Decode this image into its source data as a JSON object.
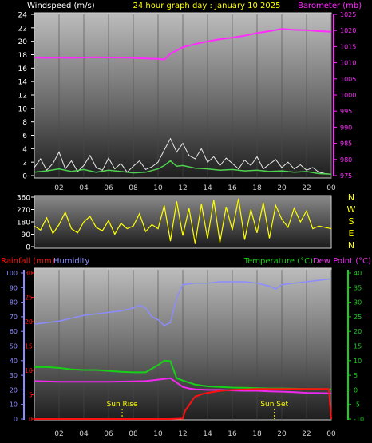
{
  "title": "24 hour graph day : January 10 2025",
  "wind_axis_label": "Windspeed (m/s)",
  "baro_axis_label": "Barometer (mb)",
  "rain_axis_label": "Rainfall (mm)",
  "hum_axis_label": "Humidity",
  "temp_axis_label": "Temperature (°C)",
  "dew_axis_label": "Dew Point (°C)",
  "sunrise_label": "Sun Rise",
  "sunset_label": "Sun Set",
  "colors": {
    "wind": "#e8e8e8",
    "gust": "#4fd14f",
    "baro": "#ff2bff",
    "dir": "#ffff00",
    "humidity": "#8c8cff",
    "temperature": "#18d018",
    "dewpoint": "#ee2aee",
    "rain": "#ff1010",
    "title": "#ffff00"
  },
  "chart_data": [
    {
      "type": "line",
      "panel": "wind_baro",
      "x_ticks": [
        "02",
        "04",
        "06",
        "08",
        "10",
        "12",
        "14",
        "16",
        "18",
        "20",
        "22",
        "00"
      ],
      "xlim": [
        0,
        24
      ],
      "y_left_ticks": [
        "0",
        "2",
        "4",
        "6",
        "8",
        "10",
        "12",
        "14",
        "16",
        "18",
        "20",
        "22",
        "24"
      ],
      "ylim_left": [
        0,
        24
      ],
      "y_right_ticks": [
        "975",
        "980",
        "985",
        "990",
        "995",
        "1000",
        "1005",
        "1010",
        "1015",
        "1020",
        "1025"
      ],
      "ylim_right": [
        975,
        1025
      ],
      "series": [
        {
          "name": "Windspeed (m/s)",
          "axis": "left",
          "x": [
            0,
            0.5,
            1,
            1.5,
            2,
            2.5,
            3,
            3.5,
            4,
            4.5,
            5,
            5.5,
            6,
            6.5,
            7,
            7.5,
            8,
            8.5,
            9,
            9.5,
            10,
            10.5,
            11,
            11.5,
            12,
            12.5,
            13,
            13.5,
            14,
            14.5,
            15,
            15.5,
            16,
            16.5,
            17,
            17.5,
            18,
            18.5,
            19,
            19.5,
            20,
            20.5,
            21,
            21.5,
            22,
            22.5,
            23,
            23.5,
            24
          ],
          "y": [
            1.2,
            2.5,
            0.8,
            1.8,
            3.5,
            1.0,
            2.2,
            0.6,
            1.5,
            3.0,
            1.2,
            0.8,
            2.6,
            1.0,
            1.8,
            0.5,
            1.4,
            2.2,
            0.9,
            1.3,
            2.0,
            3.8,
            5.5,
            3.5,
            4.8,
            3.0,
            2.5,
            4.0,
            2.0,
            2.8,
            1.5,
            2.6,
            1.8,
            1.0,
            2.3,
            1.5,
            2.8,
            1.0,
            1.7,
            2.4,
            1.2,
            2.0,
            1.0,
            1.6,
            0.8,
            1.2,
            0.5,
            0.3,
            0.2
          ]
        },
        {
          "name": "Gust",
          "axis": "left",
          "x": [
            0,
            1,
            2,
            3,
            4,
            5,
            6,
            7,
            8,
            9,
            10,
            10.5,
            11,
            11.5,
            12,
            13,
            14,
            15,
            16,
            17,
            18,
            19,
            20,
            21,
            22,
            23,
            24
          ],
          "y": [
            0.5,
            0.7,
            1.0,
            0.6,
            0.9,
            0.5,
            0.8,
            0.6,
            0.4,
            0.5,
            1.0,
            1.5,
            2.2,
            1.4,
            1.5,
            1.1,
            1.0,
            0.8,
            0.9,
            0.7,
            0.8,
            0.6,
            0.7,
            0.5,
            0.6,
            0.3,
            0.2
          ]
        },
        {
          "name": "Barometer (mb)",
          "axis": "right",
          "x": [
            0,
            1,
            2,
            3,
            4,
            5,
            6,
            7,
            8,
            9,
            10,
            10.5,
            11,
            11.5,
            12,
            13,
            14,
            15,
            16,
            17,
            18,
            19,
            20,
            21,
            22,
            23,
            24
          ],
          "y": [
            1011.6,
            1011.5,
            1011.6,
            1011.5,
            1011.6,
            1011.7,
            1011.6,
            1011.6,
            1011.5,
            1011.3,
            1011.2,
            1011.0,
            1012.8,
            1013.8,
            1014.8,
            1015.8,
            1016.6,
            1017.3,
            1017.8,
            1018.4,
            1019.2,
            1019.8,
            1020.5,
            1020.2,
            1020.1,
            1019.8,
            1019.6
          ]
        }
      ]
    },
    {
      "type": "line",
      "panel": "wind_direction",
      "ylim": [
        0,
        360
      ],
      "y_ticks": [
        "0",
        "90",
        "180",
        "270",
        "360"
      ],
      "compass_labels": [
        "N",
        "W",
        "S",
        "E",
        "N"
      ],
      "series": [
        {
          "name": "Wind Direction",
          "x": [
            0,
            0.5,
            1,
            1.5,
            2,
            2.5,
            3,
            3.5,
            4,
            4.5,
            5,
            5.5,
            6,
            6.5,
            7,
            7.5,
            8,
            8.5,
            9,
            9.5,
            10,
            10.5,
            11,
            11.5,
            12,
            12.5,
            13,
            13.5,
            14,
            14.5,
            15,
            15.5,
            16,
            16.5,
            17,
            17.5,
            18,
            18.5,
            19,
            19.5,
            20,
            20.5,
            21,
            21.5,
            22,
            22.5,
            23,
            23.5,
            24
          ],
          "y": [
            150,
            120,
            210,
            95,
            160,
            250,
            130,
            100,
            180,
            220,
            140,
            115,
            190,
            90,
            170,
            130,
            150,
            240,
            110,
            160,
            130,
            300,
            40,
            330,
            80,
            280,
            20,
            310,
            60,
            340,
            30,
            290,
            120,
            350,
            50,
            270,
            100,
            320,
            60,
            300,
            200,
            140,
            280,
            180,
            260,
            130,
            150,
            140,
            130
          ]
        }
      ]
    },
    {
      "type": "line",
      "panel": "temp_hum_rain",
      "ylim_rain": [
        0,
        30
      ],
      "y_rain_ticks": [
        "0",
        "5",
        "10",
        "15",
        "20",
        "25",
        "30"
      ],
      "ylim_humidity": [
        0,
        100
      ],
      "y_humidity_ticks": [
        "0",
        "10",
        "20",
        "30",
        "40",
        "50",
        "60",
        "70",
        "80",
        "90",
        "100"
      ],
      "ylim_temp": [
        -10,
        40
      ],
      "y_temp_ticks": [
        "-10",
        "-5",
        "0",
        "5",
        "10",
        "15",
        "20",
        "25",
        "30",
        "35",
        "40"
      ],
      "sunrise_hour": 7.1,
      "sunset_hour": 19.4,
      "series": [
        {
          "name": "Humidity",
          "x": [
            0,
            1,
            2,
            3,
            4,
            5,
            6,
            7,
            8,
            8.5,
            9,
            9.5,
            10,
            10.5,
            11,
            11.5,
            12,
            13,
            14,
            15,
            16,
            17,
            18,
            19,
            19.5,
            20,
            21,
            22,
            23,
            24
          ],
          "y": [
            65,
            66,
            67,
            69,
            71,
            72,
            73,
            74,
            76,
            78,
            76,
            70,
            68,
            64,
            66,
            83,
            92,
            93,
            93,
            94,
            94,
            94,
            93,
            91,
            89,
            92,
            93,
            94,
            95,
            96
          ]
        },
        {
          "name": "Temperature (°C)",
          "x": [
            0,
            1,
            2,
            3,
            4,
            5,
            6,
            7,
            8,
            9,
            10,
            10.5,
            11,
            11.5,
            12,
            12.5,
            13,
            14,
            15,
            16,
            17,
            18,
            19,
            20,
            21,
            22,
            23,
            24
          ],
          "y": [
            7.8,
            7.8,
            7.5,
            7.0,
            6.8,
            6.8,
            6.5,
            6.2,
            6.0,
            6.0,
            8.5,
            10.0,
            9.8,
            4.0,
            3.2,
            2.5,
            1.8,
            1.2,
            1.0,
            0.8,
            0.7,
            0.6,
            0.5,
            0.5,
            0.4,
            0.3,
            0.3,
            0.2
          ]
        },
        {
          "name": "Dew Point (°C)",
          "x": [
            0,
            2,
            4,
            6,
            8,
            9,
            10,
            11,
            11.5,
            12,
            12.5,
            13,
            14,
            15,
            16,
            17,
            18,
            19,
            20,
            21,
            22,
            23,
            24
          ],
          "y": [
            3.0,
            2.8,
            2.8,
            2.8,
            2.9,
            3.0,
            3.5,
            4.0,
            2.5,
            1.0,
            0.5,
            0.2,
            0.0,
            0.0,
            -0.2,
            -0.3,
            -0.3,
            -0.5,
            -0.6,
            -0.8,
            -1.0,
            -1.1,
            -1.2
          ]
        },
        {
          "name": "Rainfall (mm)",
          "x": [
            0,
            1,
            2,
            3,
            4,
            5,
            6,
            7,
            8,
            9,
            10,
            11,
            12,
            12.2,
            12.5,
            12.8,
            13,
            13.5,
            14,
            15,
            16,
            17,
            18,
            19,
            20,
            21,
            22,
            23,
            23.8,
            24
          ],
          "y": [
            0,
            0,
            0,
            0,
            0,
            0,
            0,
            0,
            0,
            0,
            0,
            0,
            0.1,
            1.8,
            2.8,
            4.0,
            4.6,
            5.1,
            5.4,
            5.8,
            6.0,
            6.1,
            6.2,
            6.2,
            6.2,
            6.2,
            6.2,
            6.2,
            6.2,
            0
          ]
        }
      ]
    }
  ]
}
